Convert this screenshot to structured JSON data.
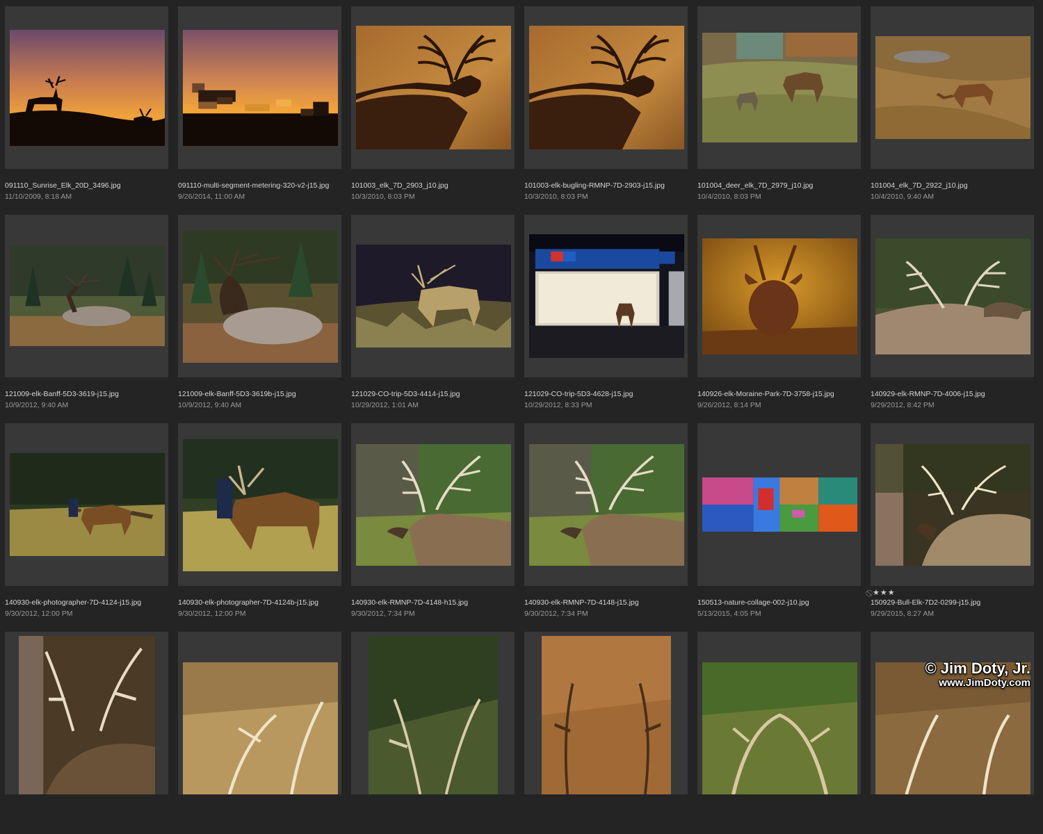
{
  "photos": [
    {
      "name": "091110_Sunrise_Elk_20D_3496.jpg",
      "date": "11/10/2009, 8:18 AM",
      "scene": "sunrise-silhouette"
    },
    {
      "name": "091110-multi-segment-metering-320-v2-j15.jpg",
      "date": "9/26/2014, 11:00 AM",
      "scene": "pixelated-sunrise"
    },
    {
      "name": "101003_elk_7D_2903_j10.jpg",
      "date": "10/3/2010, 8:03 PM",
      "scene": "bugling-elk"
    },
    {
      "name": "101003-elk-bugling-RMNP-7D-2903-j15.jpg",
      "date": "10/3/2010, 8:03 PM",
      "scene": "bugling-elk"
    },
    {
      "name": "101004_deer_elk_7D_2979_j10.jpg",
      "date": "10/4/2010, 8:03 PM",
      "scene": "deer-elk-lawn"
    },
    {
      "name": "101004_elk_7D_2922_j10.jpg",
      "date": "10/4/2010, 9:40 AM",
      "scene": "elk-grazing-slope"
    },
    {
      "name": "121009-elk-Banff-5D3-3619-j15.jpg",
      "date": "10/9/2012, 9:40 AM",
      "scene": "elk-lying-forest"
    },
    {
      "name": "121009-elk-Banff-5D3-3619b-j15.jpg",
      "date": "10/9/2012, 9:40 AM",
      "scene": "elk-lying-forest-close"
    },
    {
      "name": "121029-CO-trip-5D3-4414-j15.jpg",
      "date": "10/29/2012, 1:01 AM",
      "scene": "elk-night"
    },
    {
      "name": "121029-CO-trip-5D3-4628-j15.jpg",
      "date": "10/29/2012, 8:33 PM",
      "scene": "dominos"
    },
    {
      "name": "140926-elk-Moraine-Park-7D-3758-j15.jpg",
      "date": "9/26/2012, 8:14 PM",
      "scene": "young-elk-golden"
    },
    {
      "name": "140929-elk-RMNP-7D-4006-j15.jpg",
      "date": "9/29/2012, 8:42 PM",
      "scene": "elk-antlers-back"
    },
    {
      "name": "140930-elk-photographer-7D-4124-j15.jpg",
      "date": "9/30/2012, 12:00 PM",
      "scene": "elk-photographer"
    },
    {
      "name": "140930-elk-photographer-7D-4124b-j15.jpg",
      "date": "9/30/2012, 12:00 PM",
      "scene": "elk-photographer-close"
    },
    {
      "name": "140930-elk-RMNP-7D-4148-h15.jpg",
      "date": "9/30/2012, 7:34 PM",
      "scene": "elk-green"
    },
    {
      "name": "140930-elk-RMNP-7D-4148-j15.jpg",
      "date": "9/30/2012, 7:34 PM",
      "scene": "elk-green"
    },
    {
      "name": "150513-nature-collage-002-j10.jpg",
      "date": "5/13/2015, 4:05 PM",
      "scene": "collage"
    },
    {
      "name": "150929-Bull-Elk-7D2-0299-j15.jpg",
      "date": "9/29/2015, 8:27 AM",
      "scene": "bull-elk-tree",
      "rating": "★★★"
    },
    {
      "name": "",
      "date": "",
      "scene": "row4-a"
    },
    {
      "name": "",
      "date": "",
      "scene": "row4-b"
    },
    {
      "name": "",
      "date": "",
      "scene": "row4-c"
    },
    {
      "name": "",
      "date": "",
      "scene": "row4-d"
    },
    {
      "name": "",
      "date": "",
      "scene": "row4-e"
    },
    {
      "name": "",
      "date": "",
      "scene": "row4-f"
    }
  ],
  "watermark": {
    "line1": "© Jim Doty, Jr.",
    "line2": "www.JimDoty.com"
  }
}
